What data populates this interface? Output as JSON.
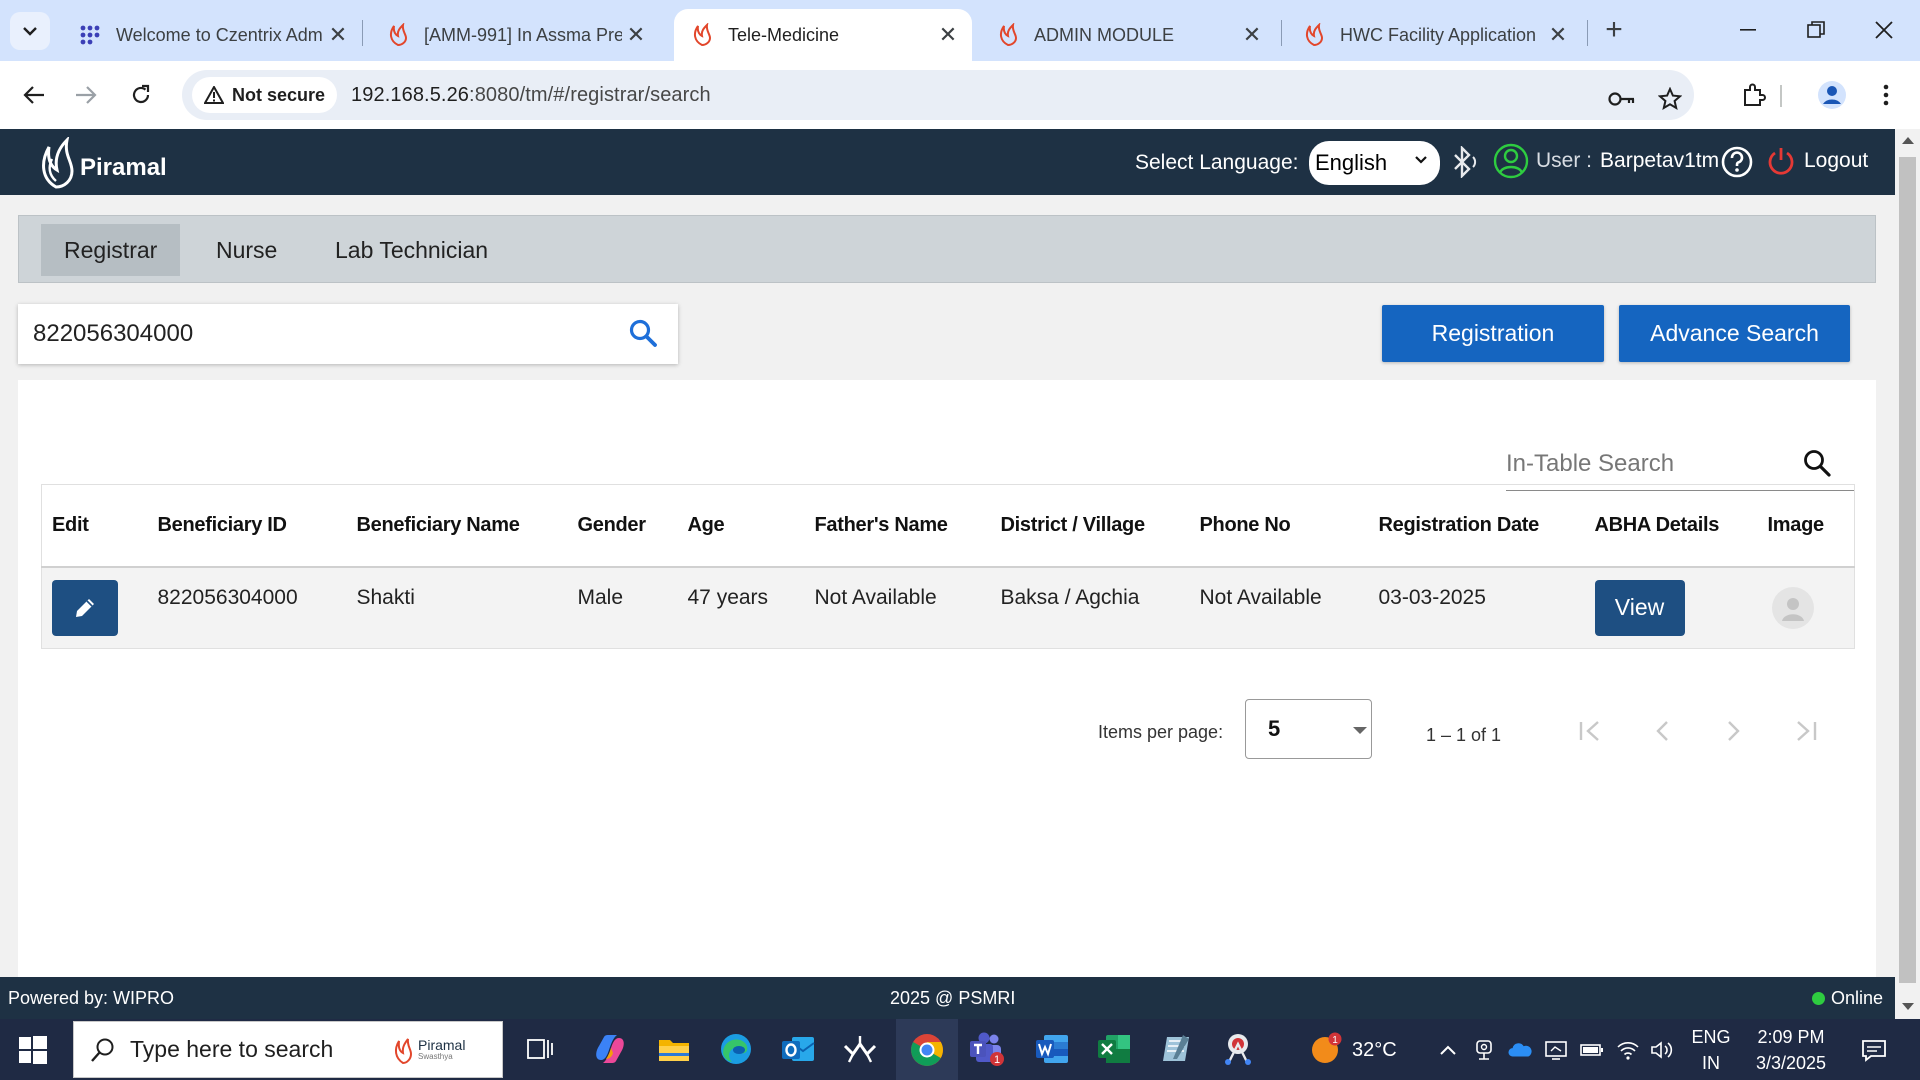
{
  "browser": {
    "tabs": [
      {
        "title": "Welcome to Czentrix Adm",
        "favicon": "grid-dots-icon"
      },
      {
        "title": "[AMM-991] In Assma Pre",
        "favicon": "piramal-flame-icon"
      },
      {
        "title": "Tele-Medicine",
        "favicon": "piramal-flame-icon",
        "active": true
      },
      {
        "title": "ADMIN MODULE",
        "favicon": "piramal-flame-icon"
      },
      {
        "title": "HWC Facility Application",
        "favicon": "piramal-flame-icon"
      }
    ],
    "security_label": "Not secure",
    "url_host": "192.168.5.26",
    "url_rest": ":8080/tm/#/registrar/search"
  },
  "header": {
    "logo_text": "Piramal",
    "language_label": "Select Language:",
    "language_value": "English",
    "user_label": "User :",
    "user_name": "Barpetav1tm",
    "logout_label": "Logout"
  },
  "roles": {
    "tabs": [
      {
        "label": "Registrar",
        "active": true
      },
      {
        "label": "Nurse"
      },
      {
        "label": "Lab Technician"
      }
    ]
  },
  "search": {
    "value": "822056304000"
  },
  "actions": {
    "registration_label": "Registration",
    "advance_search_label": "Advance Search"
  },
  "table": {
    "search_placeholder": "In-Table Search",
    "headers": [
      "Edit",
      "Beneficiary ID",
      "Beneficiary Name",
      "Gender",
      "Age",
      "Father's Name",
      "District / Village",
      "Phone No",
      "Registration Date",
      "ABHA Details",
      "Image"
    ],
    "rows": [
      {
        "beneficiary_id": "822056304000",
        "name": "Shakti",
        "gender": "Male",
        "age": "47 years",
        "father_name": "Not Available",
        "district_village": "Baksa / Agchia",
        "phone": "Not Available",
        "registration_date": "03-03-2025",
        "abha_action": "View"
      }
    ]
  },
  "paginator": {
    "items_per_page_label": "Items per page:",
    "items_per_page_value": "5",
    "range_label": "1 – 1 of 1"
  },
  "footer": {
    "powered_by": "Powered by: WIPRO",
    "copyright": "2025 @ PSMRI",
    "status": "Online"
  },
  "taskbar": {
    "search_placeholder": "Type here to search",
    "piramal_label": "Piramal",
    "piramal_sub": "Swasthya",
    "weather": "32°C",
    "weather_badge": "1",
    "teams_badge": "1",
    "lang_line1": "ENG",
    "lang_line2": "IN",
    "time": "2:09 PM",
    "date": "3/3/2025"
  },
  "colors": {
    "header_bg": "#1e3144",
    "primary_button": "#1565c0",
    "action_button": "#1e4f82",
    "tabstrip_bg": "#d3e3fd",
    "online_dot": "#2ecc40"
  }
}
